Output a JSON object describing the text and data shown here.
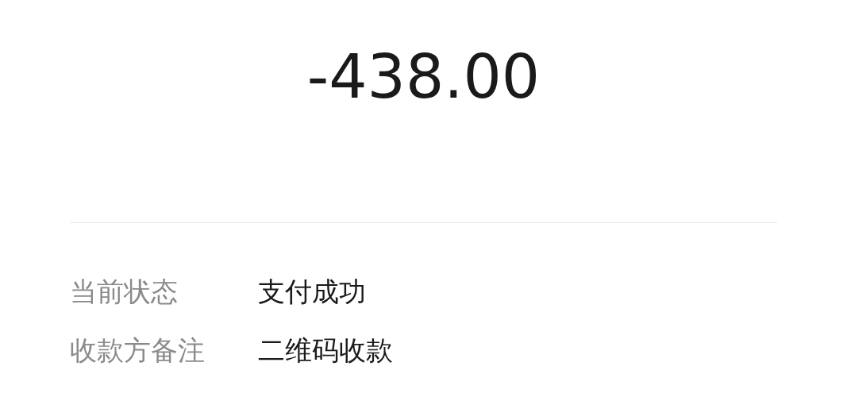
{
  "amount": "-438.00",
  "details": [
    {
      "label": "当前状态",
      "value": "支付成功"
    },
    {
      "label": "收款方备注",
      "value": "二维码收款"
    }
  ]
}
